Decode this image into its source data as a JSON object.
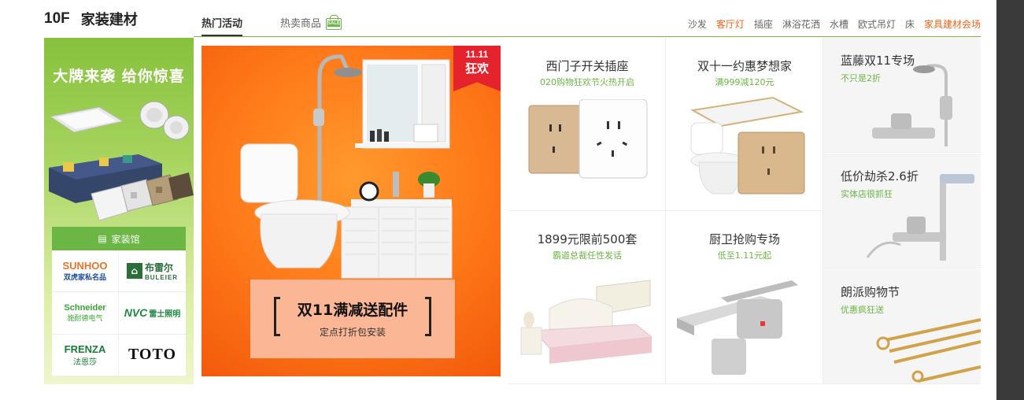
{
  "floor": {
    "number": "10F",
    "name": "家装建材"
  },
  "tabs": [
    {
      "label": "热门活动",
      "active": true
    },
    {
      "label": "热卖商品",
      "icon": "sale-bag-icon",
      "icon_text": "SALE"
    }
  ],
  "category_links": [
    "沙发",
    "客厅灯",
    "插座",
    "淋浴花洒",
    "水槽",
    "欧式吊灯",
    "床",
    "家具建材会场"
  ],
  "left_panel": {
    "slogan": "大牌来袭 给你惊喜",
    "hall_label": "家装馆",
    "brands": [
      {
        "l1": "SUNHOO",
        "l2": "双虎家私名品"
      },
      {
        "l1": "布雷尔",
        "l2": "BULEIER"
      },
      {
        "l1": "Schneider",
        "l2": "施耐德电气"
      },
      {
        "l1": "NVC",
        "l2": "雷士照明"
      },
      {
        "l1": "FRENZA",
        "l2": "法恩莎"
      },
      {
        "l1": "TOTO"
      }
    ]
  },
  "banner": {
    "tag_line1": "11.11",
    "tag_line2": "狂欢",
    "title": "双11满减送配件",
    "subtitle": "定点打折包安装"
  },
  "grid": [
    {
      "title": "西门子开关插座",
      "sub": "020购物狂欢节火热开启"
    },
    {
      "title": "双十一约惠梦想家",
      "sub": "满999减120元"
    },
    {
      "title": "1899元限前500套",
      "sub": "霸道总裁任性发话"
    },
    {
      "title": "厨卫抢购专场",
      "sub": "低至1.11元起"
    }
  ],
  "side_cards": [
    {
      "title": "蓝藤双11专场",
      "sub": "不只是2折"
    },
    {
      "title": "低价劫杀2.6折",
      "sub": "实体店很抓狂"
    },
    {
      "title": "朗派购物节",
      "sub": "优惠疯狂送"
    }
  ],
  "colors": {
    "accent_green": "#6bb644",
    "hot_red": "#e4393c",
    "orange": "#ff7a1a"
  }
}
